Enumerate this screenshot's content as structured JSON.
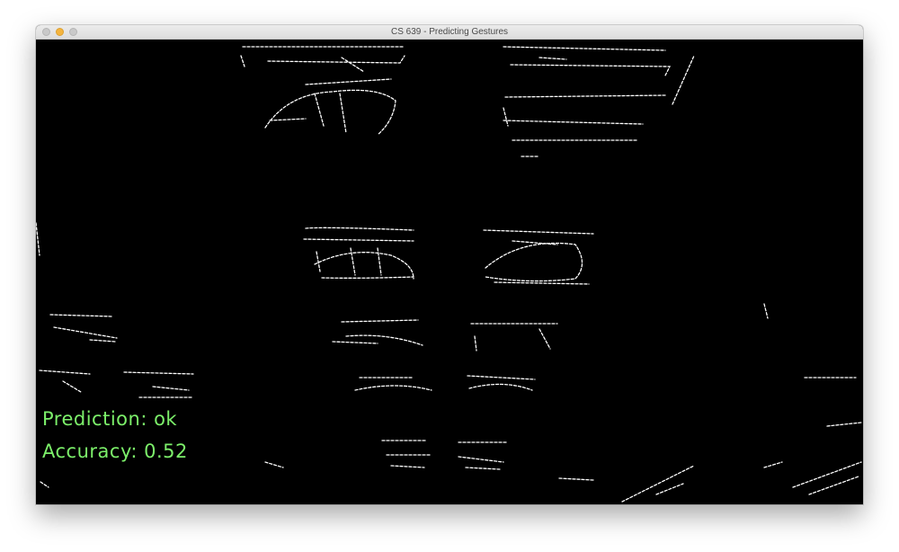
{
  "window": {
    "title": "CS 639 - Predicting Gestures",
    "buttons": [
      "close",
      "minimize",
      "maximize"
    ]
  },
  "overlay": {
    "prediction_text": "Prediction: ok",
    "accuracy_text": "Accuracy: 0.52",
    "text_color": "#7cf06a"
  },
  "feed": {
    "content": "edge-detected camera frame",
    "background_color": "#000000",
    "edge_color": "#ffffff"
  }
}
